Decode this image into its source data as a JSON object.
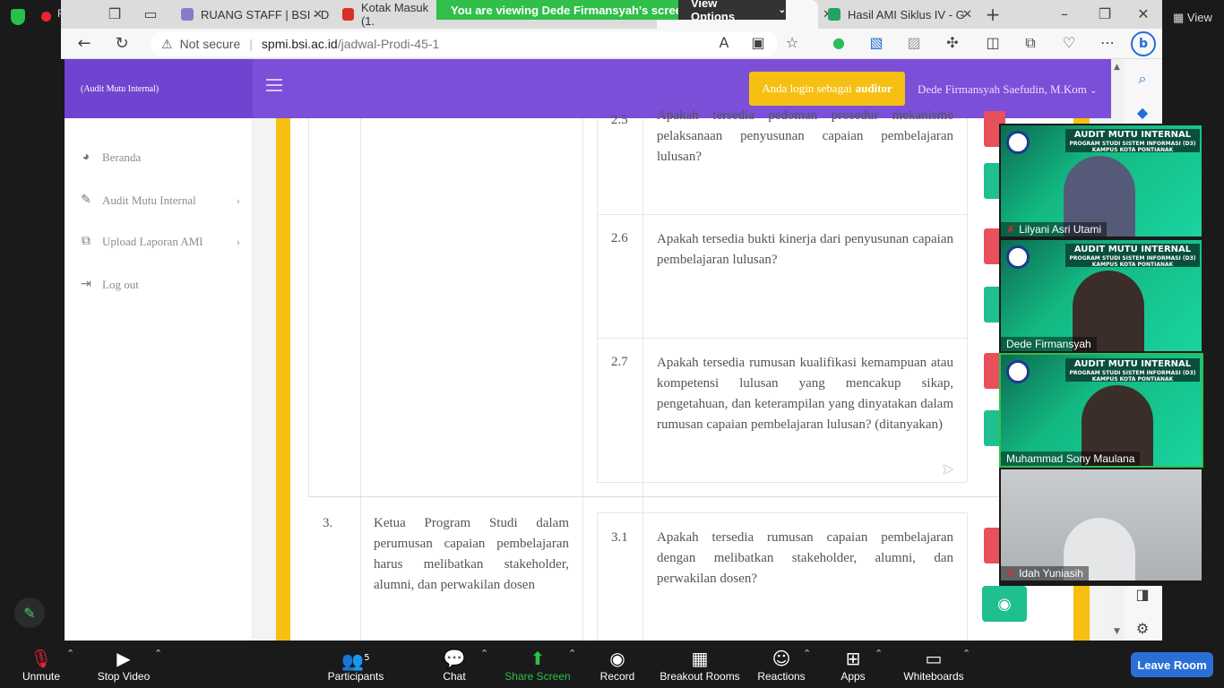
{
  "browser": {
    "recording_label": "Recording",
    "tabs": [
      {
        "title": "RUANG STAFF | BSI - D"
      },
      {
        "title": "Kotak Masuk (1."
      },
      {
        "title": "Hasil AMI Siklus IV - G"
      }
    ],
    "url_security": "Not secure",
    "url_host": "spmi.bsi.ac.id",
    "url_path": "/jadwal-Prodi-45-1",
    "view_label": "View"
  },
  "zoom_share": {
    "banner": "You are viewing Dede Firmansyah's screen",
    "view_options": "View Options"
  },
  "site": {
    "brand": "(Audit Mutu Internal)",
    "login_prefix": "Anda login sebagai",
    "login_role": "auditor",
    "user": "Dede Firmansyah Saefudin, M.Kom",
    "menu": [
      {
        "label": "Beranda",
        "icon": "dashboard-icon"
      },
      {
        "label": "Audit Mutu Internal",
        "icon": "edit-icon"
      },
      {
        "label": "Upload Laporan AMI",
        "icon": "copy-icon"
      },
      {
        "label": "Log out",
        "icon": "logout-icon"
      }
    ]
  },
  "questions": [
    {
      "num": "2.5",
      "text": "Apakah tersedia pedoman prosedur mekanisme pelaksanaan penyusunan capaian pembelajaran lulusan?"
    },
    {
      "num": "2.6",
      "text": "Apakah tersedia bukti kinerja dari penyusunan capaian pembelajaran lulusan?"
    },
    {
      "num": "2.7",
      "text": "Apakah tersedia rumusan kualifikasi kemampuan atau kompetensi lulusan yang mencakup sikap, pengetahuan, dan keterampilan yang dinyatakan dalam rumusan capaian pembelajaran lulusan? (ditanyakan)"
    },
    {
      "num": "3.1",
      "text": "Apakah tersedia rumusan capaian pembelajaran dengan melibatkan stakeholder, alumni, dan perwakilan dosen?"
    }
  ],
  "standard": {
    "num": "3.",
    "text": "Ketua Program Studi dalam perumusan capaian pembelajaran harus melibatkan stakeholder, alumni, dan perwakilan dosen"
  },
  "participants_video": [
    {
      "name": "Lilyani Asri Utami",
      "muted": true
    },
    {
      "name": "Dede Firmansyah",
      "muted": false
    },
    {
      "name": "Muhammad Sony Maulana",
      "muted": false
    },
    {
      "name": "Idah Yuniasih",
      "muted": true
    }
  ],
  "video_header": {
    "title": "AUDIT MUTU INTERNAL",
    "sub1": "PROGRAM STUDI SISTEM INFORMASI (D3)",
    "sub2": "KAMPUS KOTA PONTIANAK"
  },
  "toolbar": {
    "unmute": "Unmute",
    "stop_video": "Stop Video",
    "participants": "Participants",
    "participants_count": "5",
    "chat": "Chat",
    "share_screen": "Share Screen",
    "record": "Record",
    "breakout": "Breakout Rooms",
    "reactions": "Reactions",
    "apps": "Apps",
    "whiteboards": "Whiteboards",
    "leave": "Leave Room"
  },
  "colors": {
    "nav": "#7b4fd8",
    "badge": "#f6c012",
    "share_green": "#2fbf4a",
    "leave_blue": "#2b6fd6",
    "accent_green": "#1fbf8f"
  }
}
